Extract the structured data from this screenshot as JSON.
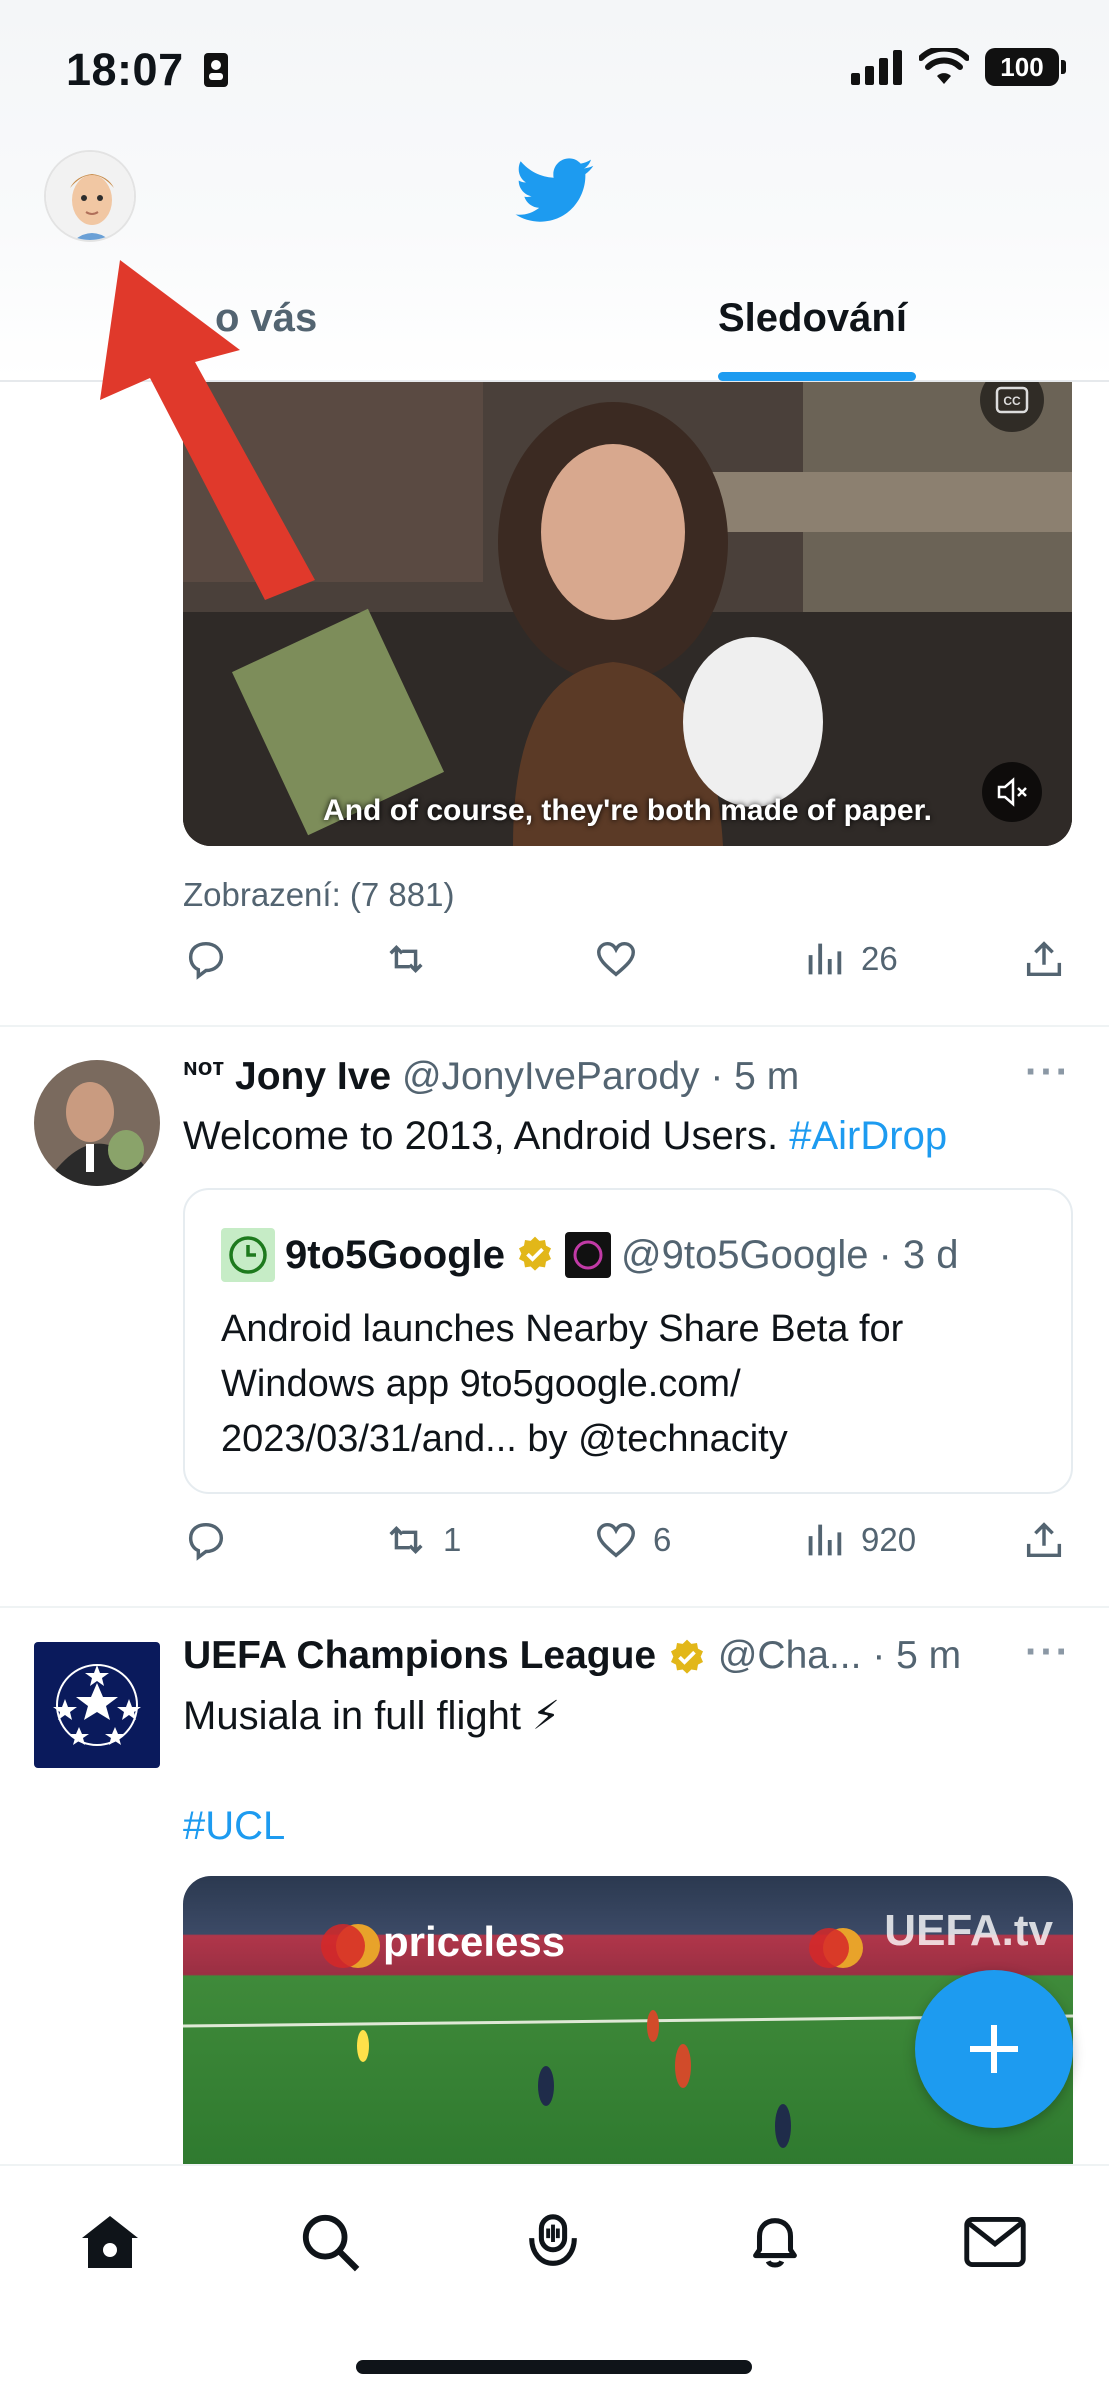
{
  "status_bar": {
    "time": "18:07",
    "battery": "100"
  },
  "header": {
    "tabs": [
      {
        "label": "Pro vás",
        "visible_label": "o vás"
      },
      {
        "label": "Sledování"
      }
    ]
  },
  "feed": {
    "video1": {
      "caption": "And of course, they're both made of paper."
    },
    "tweet1_footer": {
      "views": "Zobrazení: (7 881)",
      "stats": {
        "replies": "",
        "retweets": "",
        "likes": "",
        "views": "26"
      }
    },
    "tweet2": {
      "name_prefix": "ɴᴏᴛ",
      "name": "Jony Ive",
      "handle": "@JonyIveParody",
      "time": "· 5 m",
      "text": "Welcome to 2013, Android Users. ",
      "hashtag": "#AirDrop",
      "quote": {
        "name": "9to5Google",
        "handle": "@9to5Google",
        "time": "· 3 d",
        "text": "Android launches Nearby Share Beta for Windows app 9to5google.com/ 2023/03/31/and... by @technacity"
      },
      "stats": {
        "replies": "",
        "retweets": "1",
        "likes": "6",
        "views": "920"
      }
    },
    "tweet3": {
      "name": "UEFA Champions League",
      "handle": "@Cha...",
      "time": "· 5 m",
      "text": "Musiala in full flight ⚡",
      "hashtag": "#UCL",
      "video_text": {
        "sponsor": "priceless",
        "channel": "UEFA.tv"
      }
    },
    "more_label": "···"
  },
  "colors": {
    "accent": "#1d9bf0",
    "verified": "#e2b719",
    "annotation_arrow": "#e0392b"
  },
  "icons": [
    "profile-avatar",
    "twitter-bird-icon",
    "home-icon",
    "search-icon",
    "spaces-icon",
    "bell-icon",
    "mail-icon",
    "compose-plus-icon"
  ]
}
